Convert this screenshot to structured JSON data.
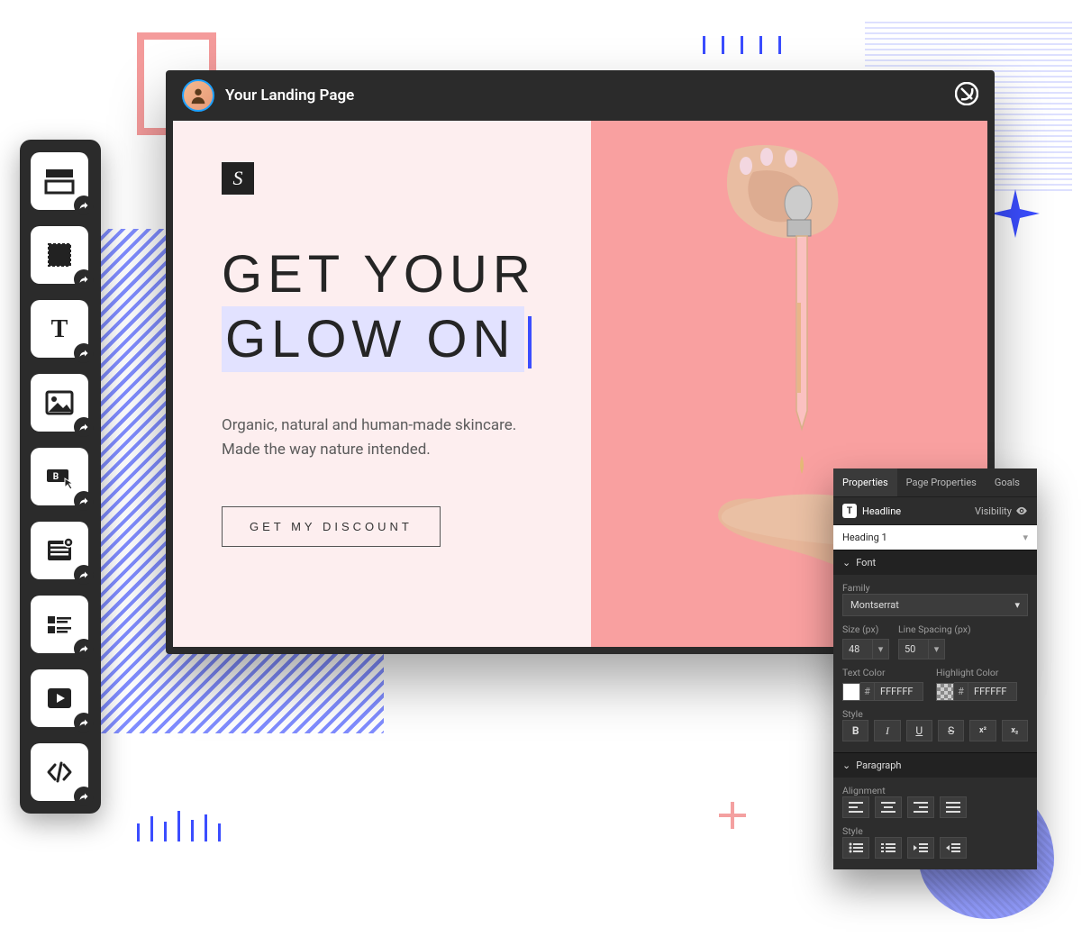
{
  "editor": {
    "title": "Your Landing Page"
  },
  "canvas": {
    "logo_letter": "S",
    "headline_line1": "GET YOUR",
    "headline_line2": "GLOW ON",
    "subcopy": "Organic, natural and human-made skincare. Made the way nature intended.",
    "cta_label": "GET MY DISCOUNT"
  },
  "toolbox": {
    "items": [
      {
        "name": "section-tool"
      },
      {
        "name": "box-tool"
      },
      {
        "name": "text-tool"
      },
      {
        "name": "image-tool"
      },
      {
        "name": "button-tool"
      },
      {
        "name": "form-tool"
      },
      {
        "name": "row-tool"
      },
      {
        "name": "video-tool"
      },
      {
        "name": "html-tool"
      }
    ]
  },
  "panel": {
    "tabs": {
      "properties": "Properties",
      "page": "Page Properties",
      "goals": "Goals"
    },
    "element_label": "Headline",
    "visibility_label": "Visibility",
    "heading_select": "Heading 1",
    "font_section": "Font",
    "family_label": "Family",
    "family_value": "Montserrat",
    "size_label": "Size (px)",
    "size_value": "48",
    "line_spacing_label": "Line Spacing (px)",
    "line_spacing_value": "50",
    "text_color_label": "Text Color",
    "text_color_hex": "FFFFFF",
    "highlight_color_label": "Highlight Color",
    "highlight_color_hex": "FFFFFF",
    "style_label": "Style",
    "style_buttons": {
      "bold": "B",
      "italic": "I",
      "underline": "U",
      "strike": "S",
      "sup": "x²",
      "sub": "x₂"
    },
    "paragraph_section": "Paragraph",
    "alignment_label": "Alignment"
  }
}
